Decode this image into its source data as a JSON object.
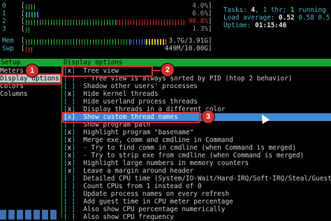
{
  "meters": [
    {
      "label": "0",
      "value": "4.0%"
    },
    {
      "label": "1",
      "value": "6.6%"
    },
    {
      "label": "2",
      "value": "90.8%"
    },
    {
      "label": "3",
      "value": "1.3%"
    },
    {
      "label": "Mem",
      "value": "3.7G/3.91G"
    },
    {
      "label": "Swp",
      "value": "449M/10.00G"
    }
  ],
  "sysinfo": {
    "tasks_label": "Tasks: ",
    "tasks": "4",
    "thr_label": ", 1 thr; ",
    "running": "1",
    "running_label": " running",
    "load_label": "Load average: ",
    "load1": "0.52",
    "load5": "0.58",
    "load15": "0.5",
    "uptime_label": "Uptime: ",
    "uptime": "01:15:46"
  },
  "header": {
    "left": "Setup",
    "right": "Display options"
  },
  "menu": [
    {
      "label": "Meters"
    },
    {
      "label": "Display options"
    },
    {
      "label": "Colors"
    },
    {
      "label": "Columns"
    }
  ],
  "options": [
    {
      "box": "[",
      "mark": "x",
      "close": "]",
      "text": "  Tree view"
    },
    {
      "box": "[",
      "mark": " ",
      "close": "]",
      "text": "  - Tree view is always sorted by PID (htop 2 behavior)"
    },
    {
      "box": "[",
      "mark": " ",
      "close": "]",
      "text": "  Shadow other users' processes"
    },
    {
      "box": "[",
      "mark": "x",
      "close": "]",
      "text": "  Hide kernel threads"
    },
    {
      "box": "[",
      "mark": " ",
      "close": "]",
      "text": "  Hide userland process threads"
    },
    {
      "box": "[",
      "mark": "x",
      "close": "]",
      "text": "  Display threads in a different color"
    },
    {
      "box": "[",
      "mark": "x",
      "close": "]",
      "text": "  Show custom thread names"
    },
    {
      "box": "[",
      "mark": " ",
      "close": "]",
      "text": "  Show program path"
    },
    {
      "box": "[",
      "mark": "x",
      "close": "]",
      "text": "  Highlight program \"basename\""
    },
    {
      "box": "[",
      "mark": "x",
      "close": "]",
      "text": "  Merge exe, comm and cmdline in Command"
    },
    {
      "box": "[",
      "mark": "x",
      "close": "]",
      "text": "  - Try to find comm in cmdline (when Command is merged)"
    },
    {
      "box": "[",
      "mark": "x",
      "close": "]",
      "text": "  - Try to strip exe from cmdline (when Command is merged)"
    },
    {
      "box": "[",
      "mark": "x",
      "close": "]",
      "text": "  Highlight large numbers in memory counters"
    },
    {
      "box": "[",
      "mark": "x",
      "close": "]",
      "text": "  Leave a margin around header"
    },
    {
      "box": "[",
      "mark": " ",
      "close": "]",
      "text": "  Detailed CPU time (System/IO-Wait/Hard-IRQ/Soft-IRQ/Steal/Guest)"
    },
    {
      "box": "[",
      "mark": " ",
      "close": "]",
      "text": "  Count CPUs from 1 instead of 0"
    },
    {
      "box": "[",
      "mark": " ",
      "close": "]",
      "text": "  Update process names on every refresh"
    },
    {
      "box": "[",
      "mark": " ",
      "close": "]",
      "text": "  Add guest time in CPU meter percentage"
    },
    {
      "box": "[",
      "mark": " ",
      "close": "]",
      "text": "  Also show CPU percentage numerically"
    },
    {
      "box": "[",
      "mark": " ",
      "close": "]",
      "text": "  Also show CPU frequency"
    }
  ],
  "annotations": [
    "1",
    "2",
    "3"
  ],
  "colors": {
    "header_bar": "#1aa533",
    "selection": "#3f8ad8",
    "annotation": "#d32f2f"
  }
}
